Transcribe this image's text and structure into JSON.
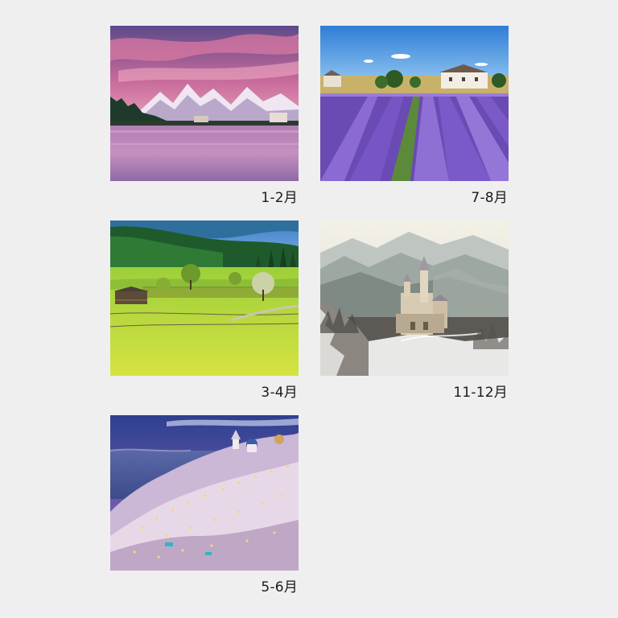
{
  "tiles": [
    {
      "caption": "1-2月"
    },
    {
      "caption": "7-8月"
    },
    {
      "caption": "3-4月"
    },
    {
      "caption": "11-12月"
    },
    {
      "caption": "5-6月"
    }
  ]
}
